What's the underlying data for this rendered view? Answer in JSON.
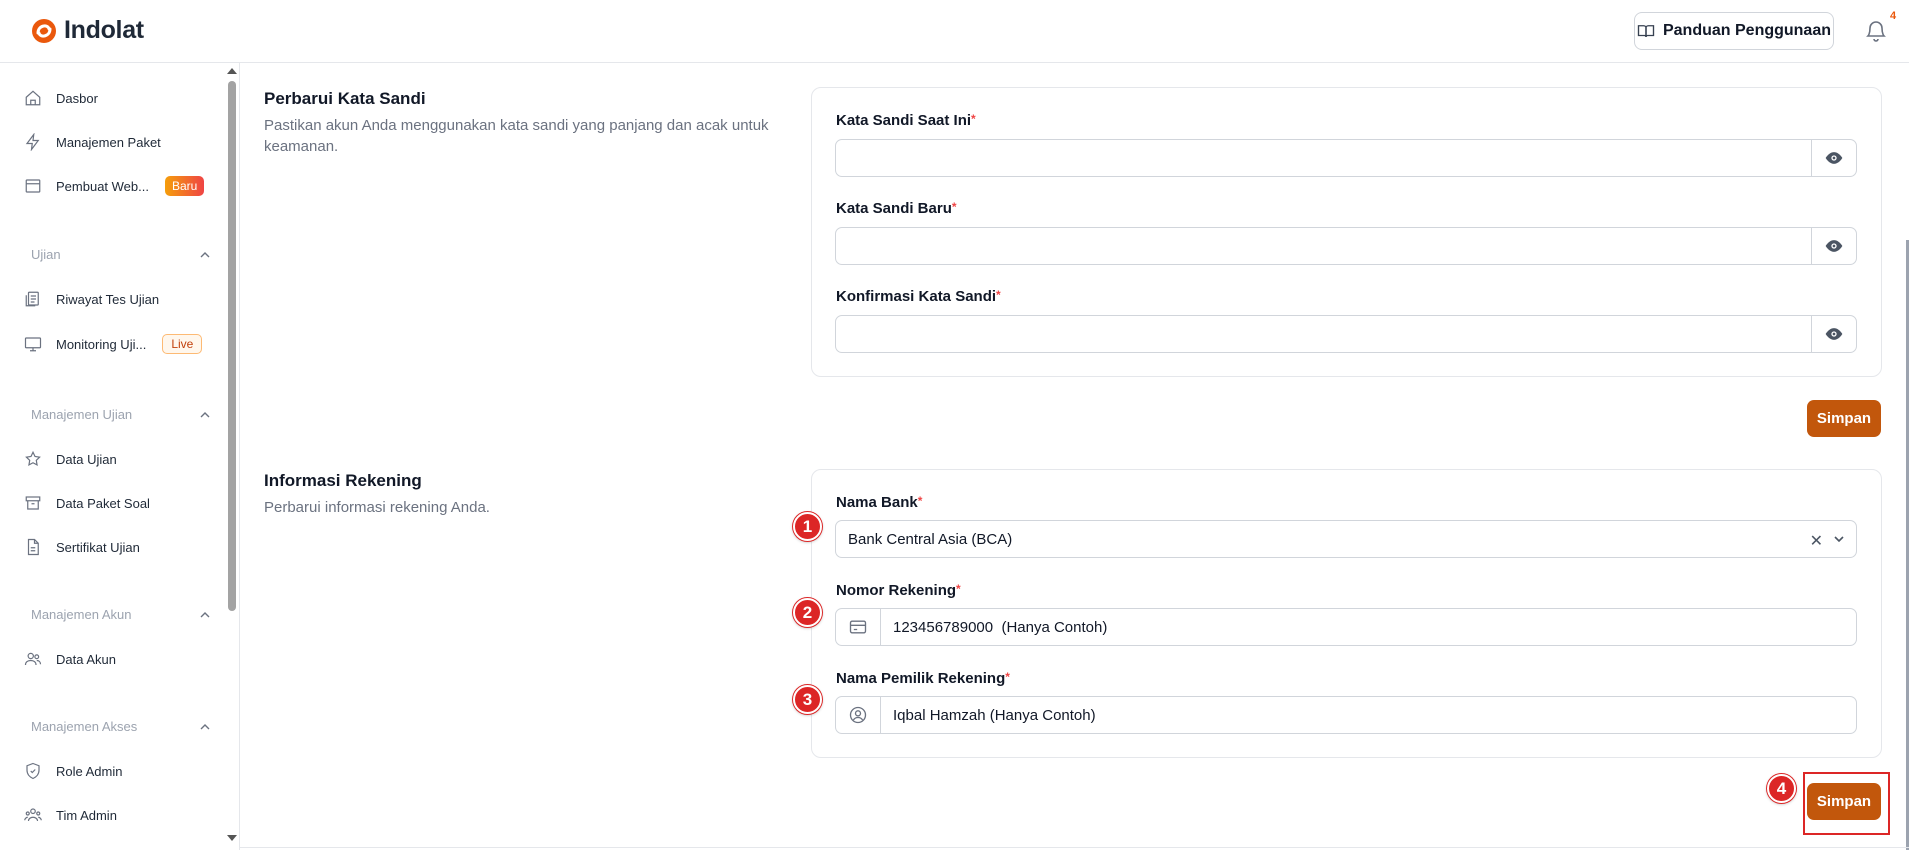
{
  "header": {
    "brand": "Indolat",
    "guide_label": "Panduan Penggunaan",
    "notification_count": "4"
  },
  "sidebar": {
    "items": [
      {
        "label": "Dasbor",
        "icon": "home-icon"
      },
      {
        "label": "Manajemen Paket",
        "icon": "bolt-icon"
      },
      {
        "label": "Pembuat Web...",
        "icon": "browser-icon",
        "badge": "Baru"
      }
    ],
    "groups": [
      {
        "label": "Ujian",
        "items": [
          {
            "label": "Riwayat Tes Ujian",
            "icon": "clipboard-icon"
          },
          {
            "label": "Monitoring Uji...",
            "icon": "monitor-icon",
            "badge": "Live"
          }
        ]
      },
      {
        "label": "Manajemen Ujian",
        "items": [
          {
            "label": "Data Ujian",
            "icon": "star-icon"
          },
          {
            "label": "Data Paket Soal",
            "icon": "archive-icon"
          },
          {
            "label": "Sertifikat Ujian",
            "icon": "document-icon"
          }
        ]
      },
      {
        "label": "Manajemen Akun",
        "items": [
          {
            "label": "Data Akun",
            "icon": "users-icon"
          }
        ]
      },
      {
        "label": "Manajemen Akses",
        "items": [
          {
            "label": "Role Admin",
            "icon": "shield-icon"
          },
          {
            "label": "Tim Admin",
            "icon": "team-icon"
          }
        ]
      }
    ]
  },
  "password_section": {
    "title": "Perbarui Kata Sandi",
    "description": "Pastikan akun Anda menggunakan kata sandi yang panjang dan acak untuk keamanan.",
    "fields": [
      {
        "label": "Kata Sandi Saat Ini",
        "value": ""
      },
      {
        "label": "Kata Sandi Baru",
        "value": ""
      },
      {
        "label": "Konfirmasi Kata Sandi",
        "value": ""
      }
    ],
    "required_mark": "*",
    "save_label": "Simpan"
  },
  "bank_section": {
    "title": "Informasi Rekening",
    "description": "Perbarui informasi rekening Anda.",
    "bank_label": "Nama Bank",
    "bank_value": "Bank Central Asia (BCA)",
    "account_number_label": "Nomor Rekening",
    "account_number_value": "123456789000  (Hanya Contoh)",
    "owner_label": "Nama Pemilik Rekening",
    "owner_value": "Iqbal Hamzah (Hanya Contoh)",
    "required_mark": "*",
    "save_label": "Simpan"
  },
  "steps": [
    "1",
    "2",
    "3",
    "4"
  ],
  "colors": {
    "accent": "#c2570c",
    "step": "#dc2626",
    "brand": "#ea580c"
  }
}
